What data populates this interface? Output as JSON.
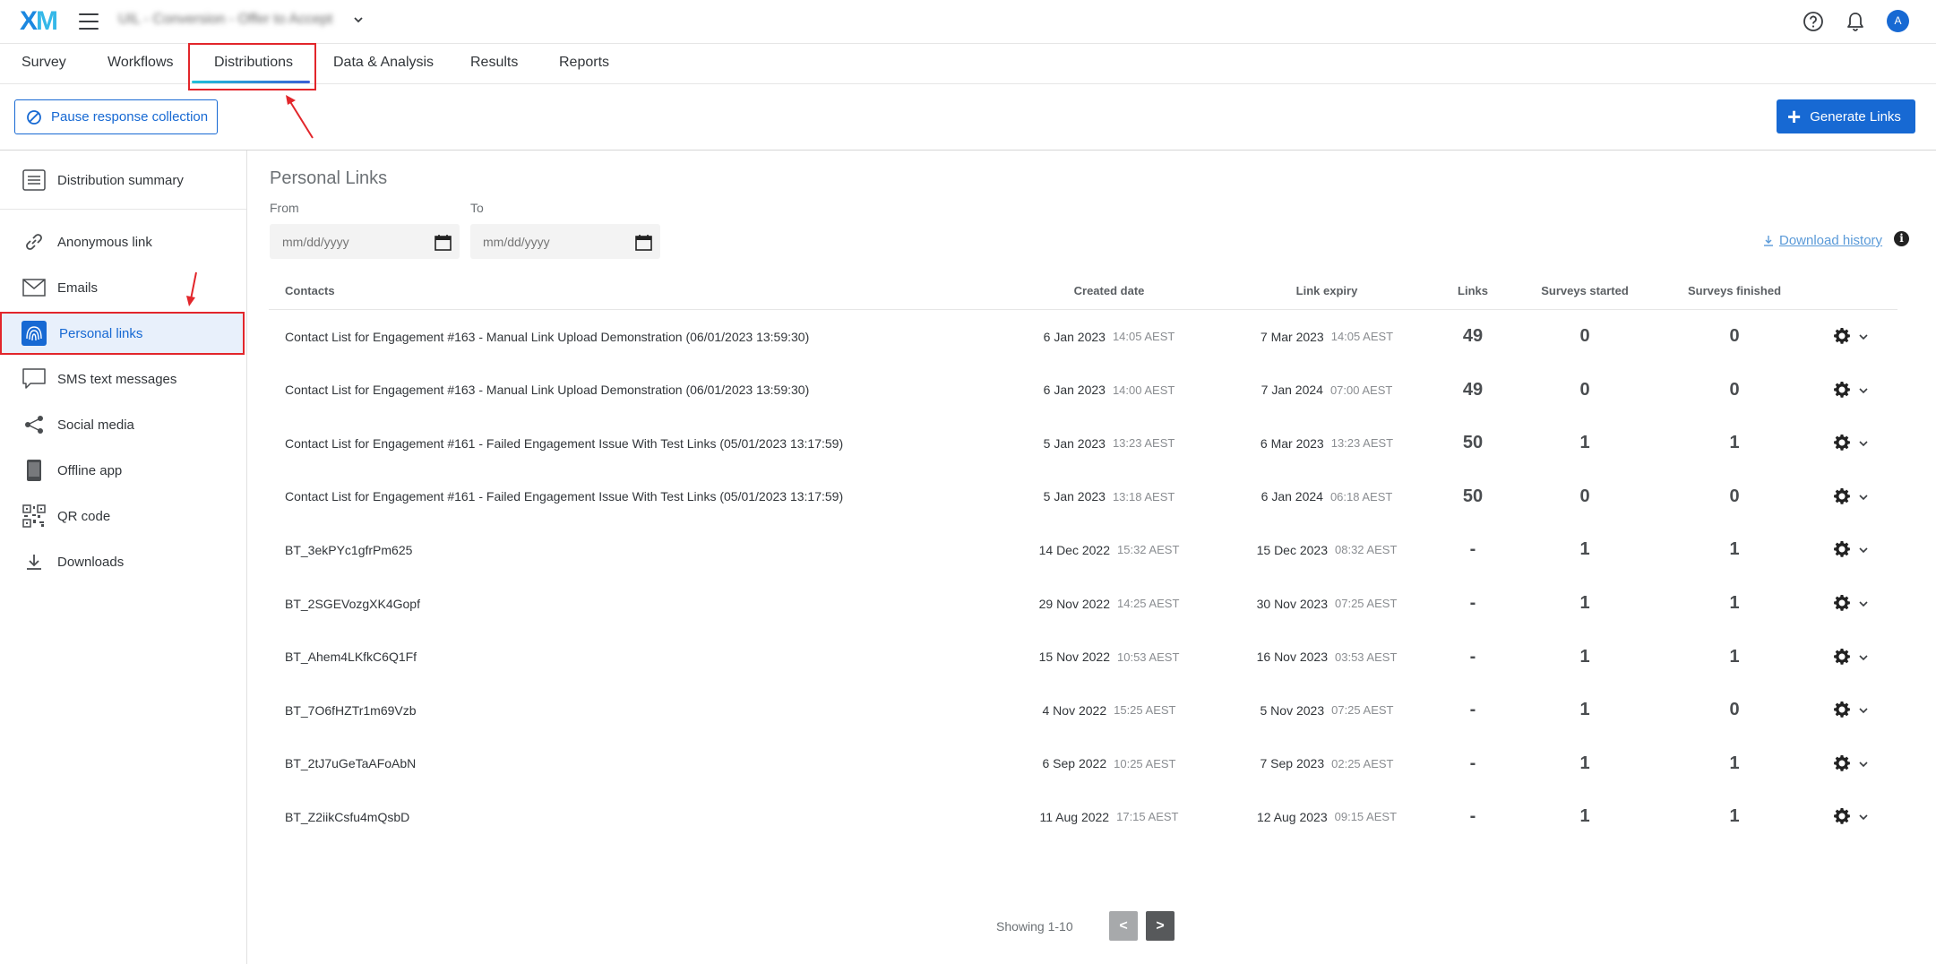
{
  "header": {
    "logo": {
      "x": "X",
      "m": "M"
    },
    "project_name": "UIL - Conversion - Offer to Accept",
    "avatar_initial": "A"
  },
  "tabs": [
    {
      "label": "Survey"
    },
    {
      "label": "Workflows"
    },
    {
      "label": "Distributions",
      "active": true
    },
    {
      "label": "Data & Analysis"
    },
    {
      "label": "Results"
    },
    {
      "label": "Reports"
    }
  ],
  "actions": {
    "pause_label": "Pause response collection",
    "generate_label": "Generate Links"
  },
  "sidebar": {
    "items": [
      {
        "label": "Distribution summary",
        "icon": "list-icon"
      },
      {
        "label": "Anonymous link",
        "icon": "link-icon"
      },
      {
        "label": "Emails",
        "icon": "envelope-icon"
      },
      {
        "label": "Personal links",
        "icon": "fingerprint-icon",
        "active": true
      },
      {
        "label": "SMS text messages",
        "icon": "chat-icon"
      },
      {
        "label": "Social media",
        "icon": "share-icon"
      },
      {
        "label": "Offline app",
        "icon": "phone-icon"
      },
      {
        "label": "QR code",
        "icon": "qr-code-icon"
      },
      {
        "label": "Downloads",
        "icon": "download-icon"
      }
    ]
  },
  "main": {
    "title": "Personal Links",
    "from_label": "From",
    "to_label": "To",
    "date_placeholder": "mm/dd/yyyy",
    "download_history": "Download history",
    "info_glyph": "i"
  },
  "table": {
    "headers": {
      "contacts": "Contacts",
      "created": "Created date",
      "expiry": "Link expiry",
      "links": "Links",
      "started": "Surveys started",
      "finished": "Surveys finished"
    },
    "rows": [
      {
        "contact": "Contact List for Engagement #163 - Manual Link Upload Demonstration (06/01/2023 13:59:30)",
        "created_date": "6 Jan 2023",
        "created_time": "14:05 AEST",
        "expiry_date": "7 Mar 2023",
        "expiry_time": "14:05 AEST",
        "links": "49",
        "started": "0",
        "finished": "0"
      },
      {
        "contact": "Contact List for Engagement #163 - Manual Link Upload Demonstration (06/01/2023 13:59:30)",
        "created_date": "6 Jan 2023",
        "created_time": "14:00 AEST",
        "expiry_date": "7 Jan 2024",
        "expiry_time": "07:00 AEST",
        "links": "49",
        "started": "0",
        "finished": "0"
      },
      {
        "contact": "Contact List for Engagement #161 - Failed Engagement Issue With Test Links (05/01/2023 13:17:59)",
        "created_date": "5 Jan 2023",
        "created_time": "13:23 AEST",
        "expiry_date": "6 Mar 2023",
        "expiry_time": "13:23 AEST",
        "links": "50",
        "started": "1",
        "finished": "1"
      },
      {
        "contact": "Contact List for Engagement #161 - Failed Engagement Issue With Test Links (05/01/2023 13:17:59)",
        "created_date": "5 Jan 2023",
        "created_time": "13:18 AEST",
        "expiry_date": "6 Jan 2024",
        "expiry_time": "06:18 AEST",
        "links": "50",
        "started": "0",
        "finished": "0"
      },
      {
        "contact": "BT_3ekPYc1gfrPm625",
        "created_date": "14 Dec 2022",
        "created_time": "15:32 AEST",
        "expiry_date": "15 Dec 2023",
        "expiry_time": "08:32 AEST",
        "links": "-",
        "started": "1",
        "finished": "1"
      },
      {
        "contact": "BT_2SGEVozgXK4Gopf",
        "created_date": "29 Nov 2022",
        "created_time": "14:25 AEST",
        "expiry_date": "30 Nov 2023",
        "expiry_time": "07:25 AEST",
        "links": "-",
        "started": "1",
        "finished": "1"
      },
      {
        "contact": "BT_Ahem4LKfkC6Q1Ff",
        "created_date": "15 Nov 2022",
        "created_time": "10:53 AEST",
        "expiry_date": "16 Nov 2023",
        "expiry_time": "03:53 AEST",
        "links": "-",
        "started": "1",
        "finished": "1"
      },
      {
        "contact": "BT_7O6fHZTr1m69Vzb",
        "created_date": "4 Nov 2022",
        "created_time": "15:25 AEST",
        "expiry_date": "5 Nov 2023",
        "expiry_time": "07:25 AEST",
        "links": "-",
        "started": "1",
        "finished": "0"
      },
      {
        "contact": "BT_2tJ7uGeTaAFoAbN",
        "created_date": "6 Sep 2022",
        "created_time": "10:25 AEST",
        "expiry_date": "7 Sep 2023",
        "expiry_time": "02:25 AEST",
        "links": "-",
        "started": "1",
        "finished": "1"
      },
      {
        "contact": "BT_Z2iikCsfu4mQsbD",
        "created_date": "11 Aug 2022",
        "created_time": "17:15 AEST",
        "expiry_date": "12 Aug 2023",
        "expiry_time": "09:15 AEST",
        "links": "-",
        "started": "1",
        "finished": "1"
      }
    ]
  },
  "pagination": {
    "showing": "Showing 1-10",
    "prev": "<",
    "next": ">"
  },
  "colors": {
    "accent": "#1769d3",
    "annotation_red": "#e2262b"
  }
}
